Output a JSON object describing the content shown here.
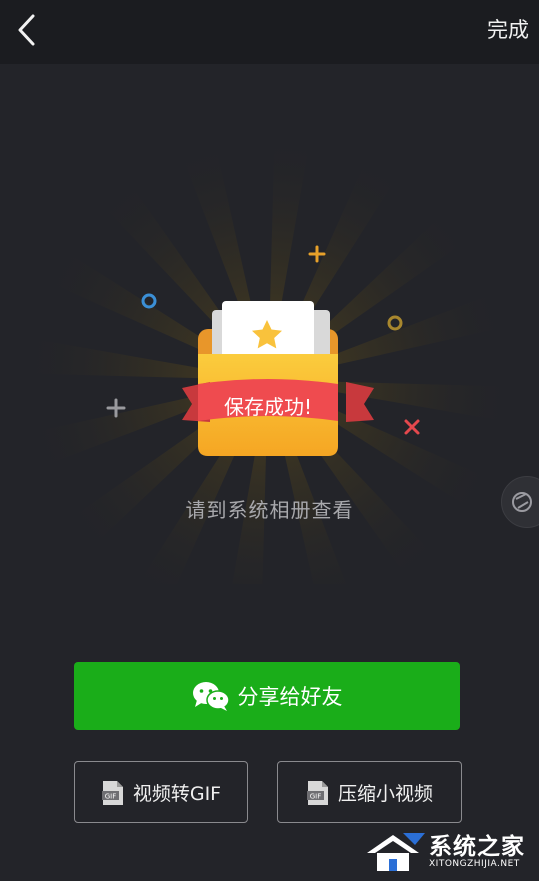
{
  "header": {
    "back_icon": "chevron-left-icon",
    "done_label": "完成"
  },
  "hero": {
    "banner_text": "保存成功!",
    "subtitle": "请到系统相册查看"
  },
  "actions": {
    "share_label": "分享给好友",
    "share_icon": "wechat-icon",
    "gif_label": "视频转GIF",
    "gif_icon_text": "GIF",
    "compress_label": "压缩小视频",
    "compress_icon_text": "GIF"
  },
  "watermark": {
    "title": "系统之家",
    "url": "XITONGZHIJIA.NET"
  },
  "colors": {
    "background": "#232429",
    "topbar": "#1b1c20",
    "share_green": "#1aad19",
    "banner_red": "#ef4b4f",
    "folder_yellow": "#f7b731"
  }
}
